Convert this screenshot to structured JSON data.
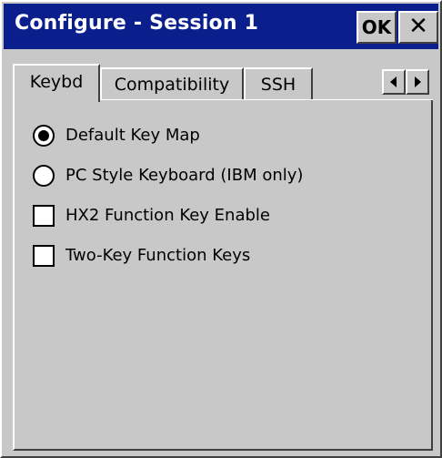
{
  "window": {
    "title": "Configure - Session 1",
    "ok_label": "OK",
    "close_label": "✕"
  },
  "tabs": [
    {
      "label": "Keybd",
      "active": true
    },
    {
      "label": "Compatibility",
      "active": false
    },
    {
      "label": "SSH",
      "active": false
    }
  ],
  "options": {
    "default_key_map": {
      "label": "Default Key Map",
      "type": "radio",
      "selected": true
    },
    "pc_style_keyboard": {
      "label": "PC Style Keyboard (IBM only)",
      "type": "radio",
      "selected": false
    },
    "hx2_function_key": {
      "label": "HX2 Function Key Enable",
      "type": "checkbox",
      "checked": false
    },
    "two_key_function": {
      "label": "Two-Key Function Keys",
      "type": "checkbox",
      "checked": false
    }
  },
  "colors": {
    "titlebar": "#0a1e8c",
    "face": "#c8c8c8"
  }
}
